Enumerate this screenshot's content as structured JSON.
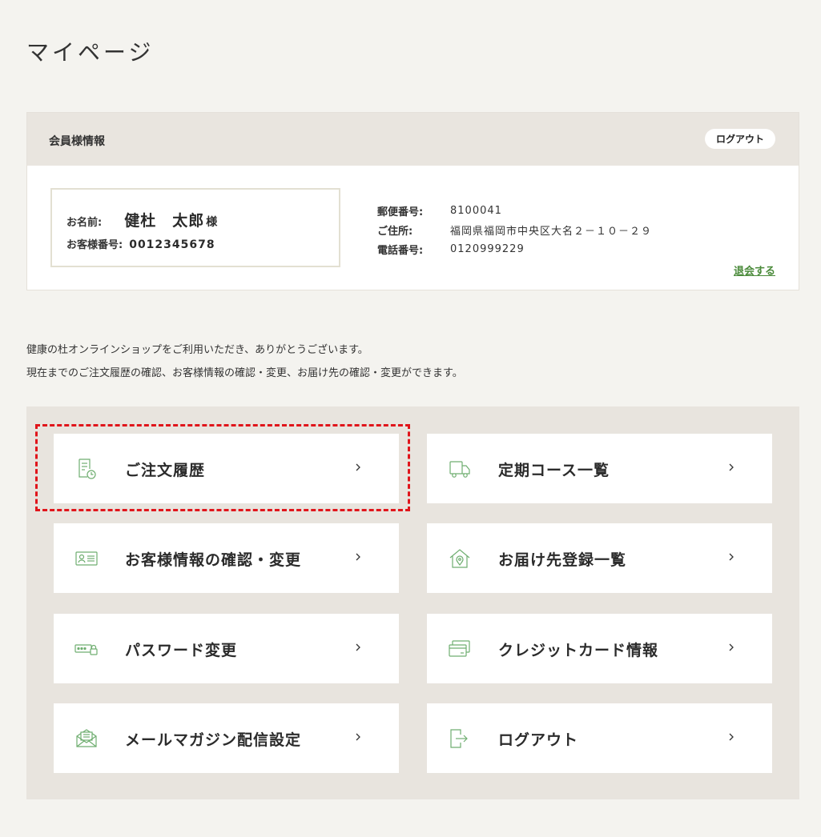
{
  "page": {
    "title": "マイページ"
  },
  "member": {
    "section_title": "会員様情報",
    "logout_label": "ログアウト",
    "name_label": "お名前:",
    "name": "健杜　太郎",
    "honorific": "様",
    "customer_no_label": "お客様番号:",
    "customer_no": "0012345678",
    "postal_label": "郵便番号:",
    "postal": "8100041",
    "address_label": "ご住所:",
    "address": "福岡県福岡市中央区大名２－１０－２９",
    "phone_label": "電話番号:",
    "phone": "0120999229",
    "withdraw_label": "退会する"
  },
  "intro": {
    "line1": "健康の杜オンラインショップをご利用いただき、ありがとうございます。",
    "line2": "現在までのご注文履歴の確認、お客様情報の確認・変更、お届け先の確認・変更ができます。"
  },
  "menu": {
    "items": [
      {
        "label": "ご注文履歴",
        "icon": "order-history-icon"
      },
      {
        "label": "定期コース一覧",
        "icon": "delivery-truck-icon"
      },
      {
        "label": "お客様情報の確認・変更",
        "icon": "id-card-icon"
      },
      {
        "label": "お届け先登録一覧",
        "icon": "home-location-icon"
      },
      {
        "label": "パスワード変更",
        "icon": "password-lock-icon"
      },
      {
        "label": "クレジットカード情報",
        "icon": "credit-card-icon"
      },
      {
        "label": "メールマガジン配信設定",
        "icon": "mail-icon"
      },
      {
        "label": "ログアウト",
        "icon": "logout-icon"
      }
    ]
  },
  "colors": {
    "accent": "#4a8a3a",
    "icon": "#6fae70",
    "highlight": "#e0151b"
  }
}
